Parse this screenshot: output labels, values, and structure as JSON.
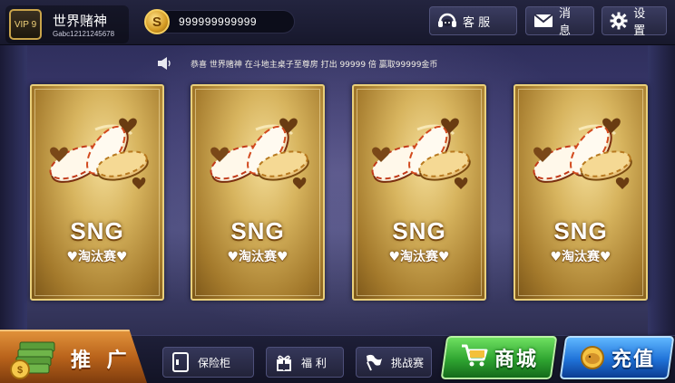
{
  "header": {
    "vip": "VIP 9",
    "player_name": "世界赌神",
    "player_id": "Gabc12121245678",
    "coins": "999999999999",
    "buttons": {
      "service": "客 服",
      "message": "消 息",
      "settings": "设 置"
    }
  },
  "announcement": "恭喜 世界赌神 在斗地主桌子至尊房 打出 99999 倍 赢取99999金币",
  "cards": [
    {
      "title": "SNG",
      "subtitle": "♥淘汰赛♥"
    },
    {
      "title": "SNG",
      "subtitle": "♥淘汰赛♥"
    },
    {
      "title": "SNG",
      "subtitle": "♥淘汰赛♥"
    },
    {
      "title": "SNG",
      "subtitle": "♥淘汰赛♥"
    }
  ],
  "footer": {
    "promo": "推 广",
    "safe": "保险柜",
    "welfare": "福 利",
    "challenge": "挑战赛",
    "shop": "商城",
    "recharge": "充值"
  },
  "colors": {
    "gold": "#d7b45e",
    "shop_green": "#2fa531",
    "recharge_blue": "#1f72d8",
    "promo_orange": "#b9631b"
  },
  "icons": {
    "coin": "S"
  }
}
